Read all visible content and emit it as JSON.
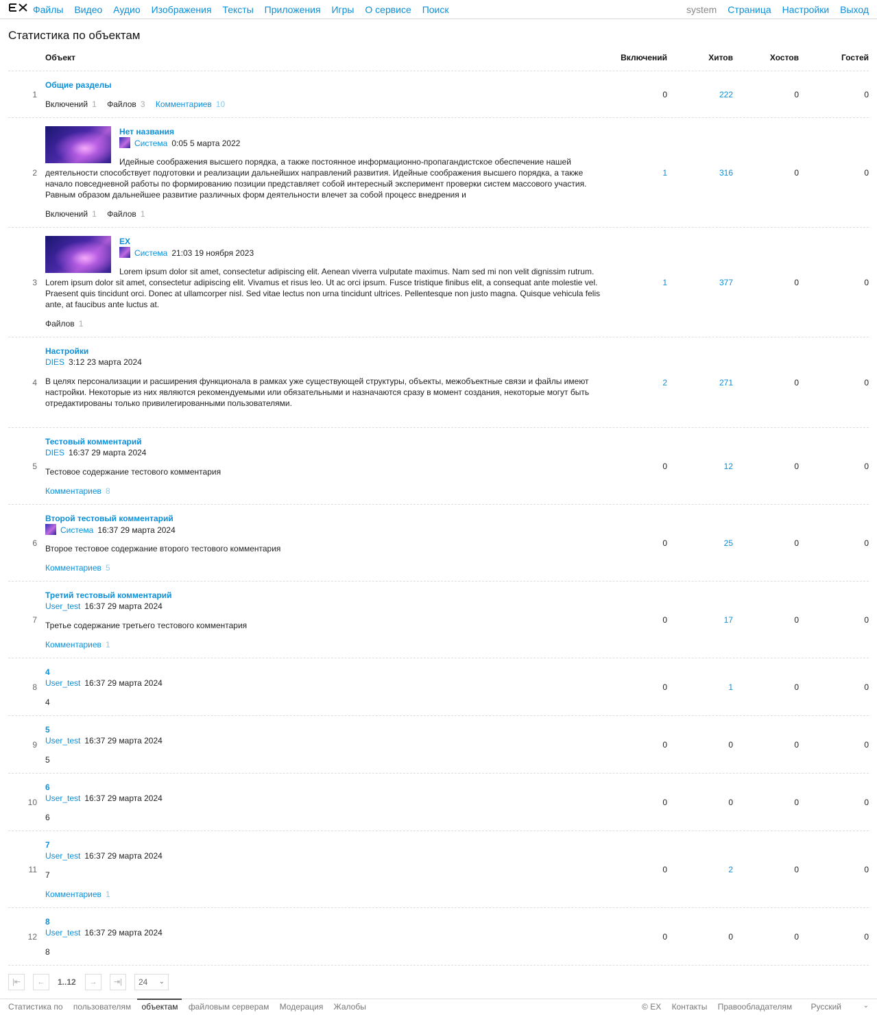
{
  "app": {
    "logo": "EX"
  },
  "nav": {
    "items": [
      "Файлы",
      "Видео",
      "Аудио",
      "Изображения",
      "Тексты",
      "Приложения",
      "Игры",
      "О сервисе",
      "Поиск"
    ],
    "user": "system",
    "right": [
      "Страница",
      "Настройки",
      "Выход"
    ]
  },
  "page": {
    "title": "Статистика по объектам"
  },
  "table": {
    "headers": {
      "object": "Объект",
      "inclusions": "Включений",
      "hits": "Хитов",
      "hosts": "Хостов",
      "guests": "Гостей"
    },
    "rows": [
      {
        "num": "1",
        "title": "Общие разделы",
        "counts": [
          {
            "label": "Включений",
            "n": "1"
          },
          {
            "label": "Файлов",
            "n": "3"
          },
          {
            "label": "Комментариев",
            "n": "10",
            "link": true
          }
        ],
        "inc": "0",
        "hits": "222",
        "hosts": "0",
        "guests": "0"
      },
      {
        "num": "2",
        "title": "Нет названия",
        "author": "Система",
        "date": "0:05 5 марта 2022",
        "text": "Идейные соображения высшего порядка, а также постоянное информационно-пропагандистское обеспечение нашей деятельности способствует подготовки и реализации дальнейших направлений развития. Идейные соображения высшего порядка, а также начало повседневной работы по формированию позиции представляет собой интересный эксперимент проверки систем массового участия. Равным образом дальнейшее развитие различных форм деятельности влечет за собой процесс внедрения и",
        "counts": [
          {
            "label": "Включений",
            "n": "1"
          },
          {
            "label": "Файлов",
            "n": "1"
          }
        ],
        "inc": "1",
        "hits": "316",
        "hosts": "0",
        "guests": "0"
      },
      {
        "num": "3",
        "title": "EX",
        "author": "Система",
        "date": "21:03 19 ноября 2023",
        "text": "Lorem ipsum dolor sit amet, consectetur adipiscing elit. Aenean viverra vulputate maximus. Nam sed mi non velit dignissim rutrum. Lorem ipsum dolor sit amet, consectetur adipiscing elit. Vivamus et risus leo. Ut ac orci ipsum. Fusce tristique finibus elit, a consequat ante molestie vel. Praesent quis tincidunt orci. Donec at ullamcorper nisl. Sed vitae lectus non urna tincidunt ultrices. Pellentesque non justo magna. Quisque vehicula felis ante, at faucibus ante luctus at.",
        "counts": [
          {
            "label": "Файлов",
            "n": "1"
          }
        ],
        "inc": "1",
        "hits": "377",
        "hosts": "0",
        "guests": "0"
      },
      {
        "num": "4",
        "title": "Настройки",
        "author": "DIES",
        "date": "3:12 23 марта 2024",
        "text": "В целях персонализации и расширения функционала в рамках уже существующей структуры, объекты, межобъектные связи и файлы имеют настройки. Некоторые из них являются рекомендуемыми или обязательными и назначаются сразу в момент создания, некоторые могут быть отредактированы только привилегированными пользователями.",
        "inc": "2",
        "hits": "271",
        "hosts": "0",
        "guests": "0"
      },
      {
        "num": "5",
        "title": "Тестовый комментарий",
        "author": "DIES",
        "date": "16:37 29 марта 2024",
        "text": "Тестовое содержание тестового комментария",
        "counts": [
          {
            "label": "Комментариев",
            "n": "8",
            "link": true
          }
        ],
        "inc": "0",
        "hits": "12",
        "hosts": "0",
        "guests": "0"
      },
      {
        "num": "6",
        "title": "Второй тестовый комментарий",
        "author": "Система",
        "date": "16:37 29 марта 2024",
        "text": "Второе тестовое содержание второго тестового комментария",
        "counts": [
          {
            "label": "Комментариев",
            "n": "5",
            "link": true
          }
        ],
        "inc": "0",
        "hits": "25",
        "hosts": "0",
        "guests": "0"
      },
      {
        "num": "7",
        "title": "Третий тестовый комментарий",
        "author": "User_test",
        "date": "16:37 29 марта 2024",
        "text": "Третье содержание третьего тестового комментария",
        "counts": [
          {
            "label": "Комментариев",
            "n": "1",
            "link": true
          }
        ],
        "inc": "0",
        "hits": "17",
        "hosts": "0",
        "guests": "0"
      },
      {
        "num": "8",
        "title": "4",
        "author": "User_test",
        "date": "16:37 29 марта 2024",
        "text": "4",
        "inc": "0",
        "hits": "1",
        "hosts": "0",
        "guests": "0"
      },
      {
        "num": "9",
        "title": "5",
        "author": "User_test",
        "date": "16:37 29 марта 2024",
        "text": "5",
        "inc": "0",
        "hits": "0",
        "hosts": "0",
        "guests": "0"
      },
      {
        "num": "10",
        "title": "6",
        "author": "User_test",
        "date": "16:37 29 марта 2024",
        "text": "6",
        "inc": "0",
        "hits": "0",
        "hosts": "0",
        "guests": "0"
      },
      {
        "num": "11",
        "title": "7",
        "author": "User_test",
        "date": "16:37 29 марта 2024",
        "text": "7",
        "counts": [
          {
            "label": "Комментариев",
            "n": "1",
            "link": true
          }
        ],
        "inc": "0",
        "hits": "2",
        "hosts": "0",
        "guests": "0"
      },
      {
        "num": "12",
        "title": "8",
        "author": "User_test",
        "date": "16:37 29 марта 2024",
        "text": "8",
        "inc": "0",
        "hits": "0",
        "hosts": "0",
        "guests": "0"
      }
    ]
  },
  "pager": {
    "range": "1..12",
    "per_page": "24"
  },
  "footer": {
    "left": [
      "Статистика по",
      "пользователям",
      "объектам",
      "файловым серверам",
      "Модерация",
      "Жалобы"
    ],
    "active_index": 2,
    "right": [
      "© EX",
      "Контакты",
      "Правообладателям"
    ],
    "language": "Русский"
  },
  "colors": {
    "link": "#0a8fd8",
    "muted": "#999999",
    "border": "#dddddd"
  }
}
